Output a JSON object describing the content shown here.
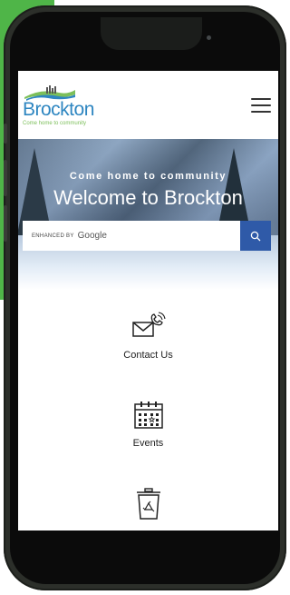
{
  "site": {
    "logo_name": "Brockton",
    "logo_tagline": "Come home to community"
  },
  "hero": {
    "subtitle": "Come home to community",
    "title": "Welcome to Brockton"
  },
  "search": {
    "enhanced_by": "ENHANCED BY",
    "brand": "Google"
  },
  "tiles": [
    {
      "label": "Contact Us",
      "icon": "envelope-phone-icon"
    },
    {
      "label": "Events",
      "icon": "calendar-icon"
    },
    {
      "label": "",
      "icon": "recycle-bin-icon"
    }
  ],
  "colors": {
    "backdrop_green": "#4fb548",
    "logo_blue": "#2e86c1",
    "search_button": "#2f5aa8"
  }
}
